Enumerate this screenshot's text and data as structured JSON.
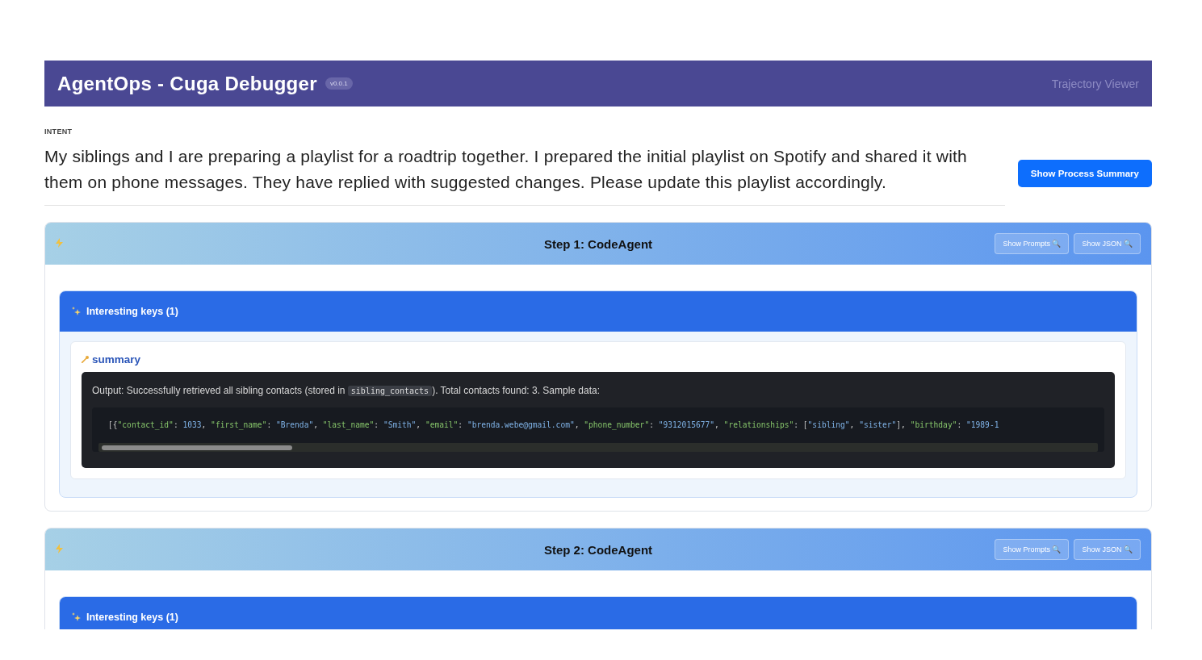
{
  "header": {
    "title": "AgentOps - Cuga Debugger",
    "version": "v0.0.1",
    "subtitle": "Trajectory Viewer"
  },
  "intent": {
    "label": "INTENT",
    "text": "My siblings and I are preparing a playlist for a roadtrip together. I prepared the initial playlist on Spotify and shared it with them on phone messages. They have replied with suggested changes. Please update this playlist accordingly.",
    "button": "Show Process Summary"
  },
  "steps": [
    {
      "title": "Step 1: CodeAgent",
      "buttons": [
        "Show Prompts 🔍",
        "Show JSON 🔍"
      ],
      "keys_title": "Interesting keys (1)",
      "entries": [
        {
          "key": "summary",
          "output": [
            {
              "kind": "text",
              "text": "Output: Successfully retrieved all sibling contacts (stored in "
            },
            {
              "kind": "code",
              "text": "sibling_contacts"
            },
            {
              "kind": "text",
              "text": "). Total contacts found: 3. Sample data:"
            }
          ],
          "code": [
            {
              "kind": "punct",
              "text": "[{"
            },
            {
              "kind": "key",
              "text": "\"contact_id\""
            },
            {
              "kind": "punct",
              "text": ": "
            },
            {
              "kind": "value",
              "text": "1033"
            },
            {
              "kind": "punct",
              "text": ", "
            },
            {
              "kind": "key",
              "text": "\"first_name\""
            },
            {
              "kind": "punct",
              "text": ": "
            },
            {
              "kind": "value",
              "text": "\"Brenda\""
            },
            {
              "kind": "punct",
              "text": ", "
            },
            {
              "kind": "key",
              "text": "\"last_name\""
            },
            {
              "kind": "punct",
              "text": ": "
            },
            {
              "kind": "value",
              "text": "\"Smith\""
            },
            {
              "kind": "punct",
              "text": ", "
            },
            {
              "kind": "key",
              "text": "\"email\""
            },
            {
              "kind": "punct",
              "text": ": "
            },
            {
              "kind": "value",
              "text": "\"brenda.webe@gmail.com\""
            },
            {
              "kind": "punct",
              "text": ", "
            },
            {
              "kind": "key",
              "text": "\"phone_number\""
            },
            {
              "kind": "punct",
              "text": ": "
            },
            {
              "kind": "value",
              "text": "\"9312015677\""
            },
            {
              "kind": "punct",
              "text": ", "
            },
            {
              "kind": "key",
              "text": "\"relationships\""
            },
            {
              "kind": "punct",
              "text": ": ["
            },
            {
              "kind": "value",
              "text": "\"sibling\""
            },
            {
              "kind": "punct",
              "text": ", "
            },
            {
              "kind": "value",
              "text": "\"sister\""
            },
            {
              "kind": "punct",
              "text": "], "
            },
            {
              "kind": "key",
              "text": "\"birthday\""
            },
            {
              "kind": "punct",
              "text": ": "
            },
            {
              "kind": "value",
              "text": "\"1989-1"
            }
          ]
        }
      ]
    },
    {
      "title": "Step 2: CodeAgent",
      "buttons": [
        "Show Prompts 🔍",
        "Show JSON 🔍"
      ],
      "keys_title": "Interesting keys (1)"
    }
  ]
}
